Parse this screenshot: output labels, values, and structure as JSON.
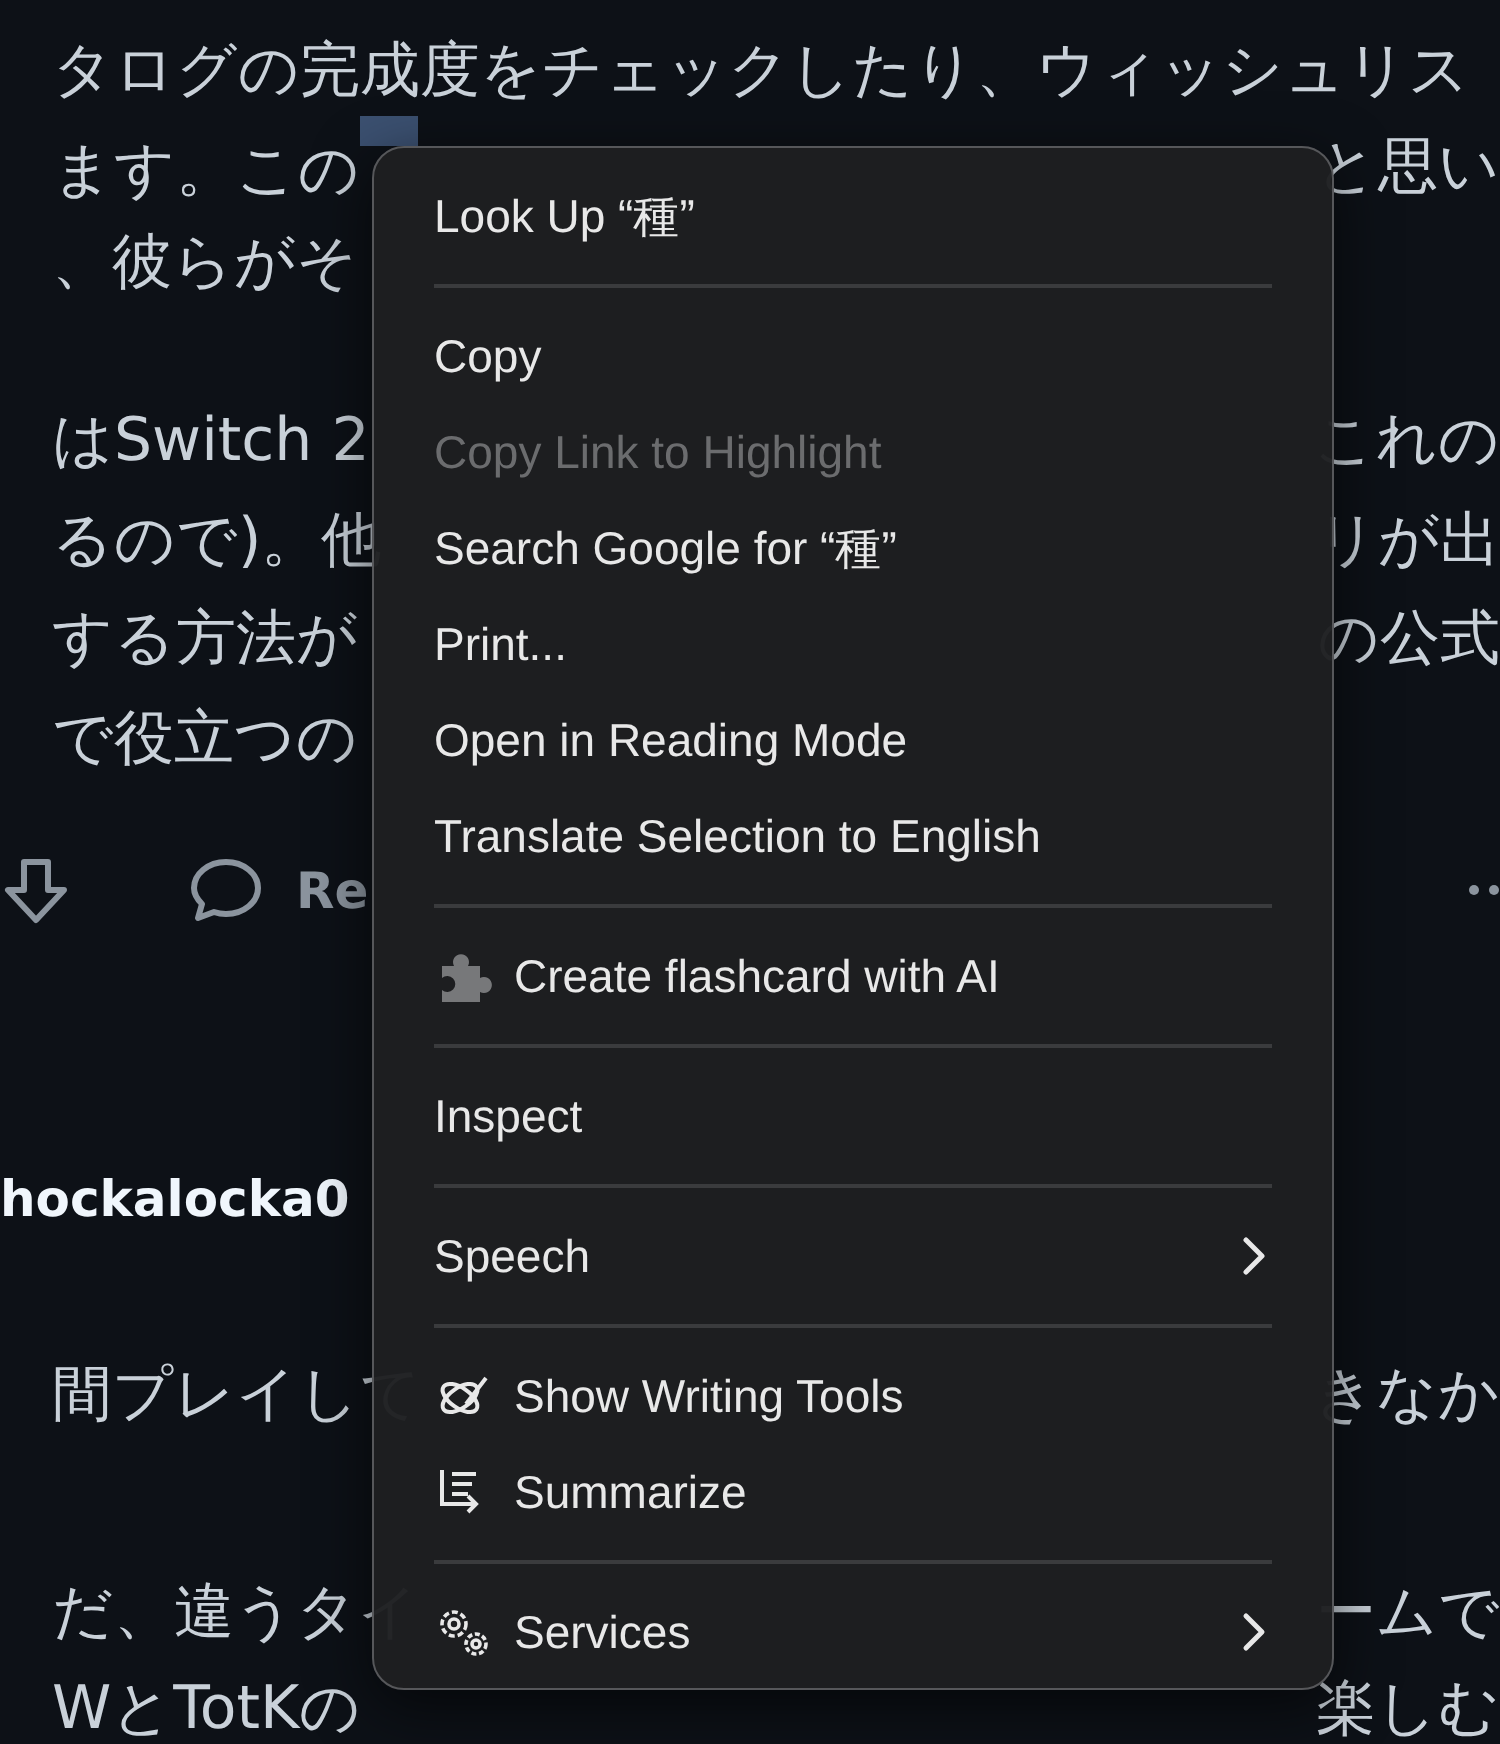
{
  "article": {
    "paragraphs": [
      {
        "lines": [
          {
            "left": "タログの完成度をチェックしたり、ウィッシュリス"
          },
          {
            "left": "ます。この",
            "selection": true,
            "right": "と思い"
          },
          {
            "left": "、彼らがそ"
          }
        ]
      },
      {
        "lines": [
          {
            "left": "はSwitch 2",
            "right": "これの"
          },
          {
            "left": "るので)。他",
            "right": "リが出"
          },
          {
            "left": "する方法が",
            "right": "の公式"
          },
          {
            "left": "で役立つの"
          }
        ]
      }
    ],
    "actions": {
      "reply_label": "Re"
    },
    "author": "hockalocka0",
    "reply_paragraphs": [
      {
        "lines": [
          {
            "left": "間プレイして",
            "right": "きなか"
          }
        ]
      },
      {
        "lines": [
          {
            "left": "だ、違うタイ",
            "right": "ームで"
          },
          {
            "left": "WとTotKの",
            "right": "楽しむ"
          }
        ]
      }
    ]
  },
  "context_menu": {
    "sections": [
      {
        "items": [
          {
            "label": "Look Up “種”",
            "kind": "plain",
            "disabled": false,
            "submenu": false
          }
        ]
      },
      {
        "items": [
          {
            "label": "Copy",
            "kind": "plain",
            "disabled": false,
            "submenu": false
          },
          {
            "label": "Copy Link to Highlight",
            "kind": "plain",
            "disabled": true,
            "submenu": false
          },
          {
            "label": "Search Google for “種”",
            "kind": "plain",
            "disabled": false,
            "submenu": false
          },
          {
            "label": "Print...",
            "kind": "plain",
            "disabled": false,
            "submenu": false
          },
          {
            "label": "Open in Reading Mode",
            "kind": "plain",
            "disabled": false,
            "submenu": false
          },
          {
            "label": "Translate Selection to English",
            "kind": "plain",
            "disabled": false,
            "submenu": false
          }
        ]
      },
      {
        "items": [
          {
            "label": "Create flashcard with AI",
            "kind": "extension",
            "disabled": false,
            "submenu": false
          }
        ]
      },
      {
        "items": [
          {
            "label": "Inspect",
            "kind": "plain",
            "disabled": false,
            "submenu": false
          }
        ]
      },
      {
        "items": [
          {
            "label": "Speech",
            "kind": "plain",
            "disabled": false,
            "submenu": true
          }
        ]
      },
      {
        "items": [
          {
            "label": "Show Writing Tools",
            "kind": "writing-tools",
            "disabled": false,
            "submenu": false
          },
          {
            "label": "Summarize",
            "kind": "summarize",
            "disabled": false,
            "submenu": false
          }
        ]
      },
      {
        "items": [
          {
            "label": "Services",
            "kind": "services",
            "disabled": false,
            "submenu": true
          }
        ]
      }
    ]
  }
}
